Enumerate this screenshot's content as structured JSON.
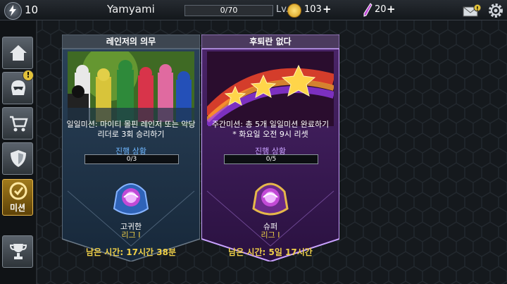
{
  "topbar": {
    "player_level": "10",
    "username": "Yamyami",
    "xp": "0/70",
    "level_text": "Lv. 1",
    "coins": "103",
    "gems": "20"
  },
  "sidebar": {
    "items": [
      {
        "name": "home",
        "label": ""
      },
      {
        "name": "rangers",
        "label": ""
      },
      {
        "name": "shop",
        "label": ""
      },
      {
        "name": "shield",
        "label": ""
      },
      {
        "name": "missions",
        "label": "미션"
      },
      {
        "name": "trophy",
        "label": ""
      }
    ]
  },
  "missions": [
    {
      "title": "레인저의 의무",
      "description": "일일미션: 마이티 몰핀 레인저 또는 악당 리더로 3회 승리하기",
      "progress_label": "진행 상황",
      "progress_text": "0/3",
      "progress_fraction": 0,
      "reward_name": "고귀한",
      "reward_league": "리그 I",
      "time_label": "남은 시간: 17시간 38분"
    },
    {
      "title": "후퇴란 없다",
      "description": "주간미션: 총 5개 일일미션 완료하기",
      "description_note": "* 화요일 오전 9시 리셋",
      "progress_label": "진행 상황",
      "progress_text": "0/5",
      "progress_fraction": 0,
      "reward_name": "슈퍼",
      "reward_league": "리그 I",
      "time_label": "남은 시간: 5일 17시간"
    }
  ],
  "colors": {
    "accent_gold": "#f0d048",
    "card1_bg": "#1e3347",
    "card2_bg": "#3a1d55",
    "card2_glow": "#c9a2ff"
  }
}
